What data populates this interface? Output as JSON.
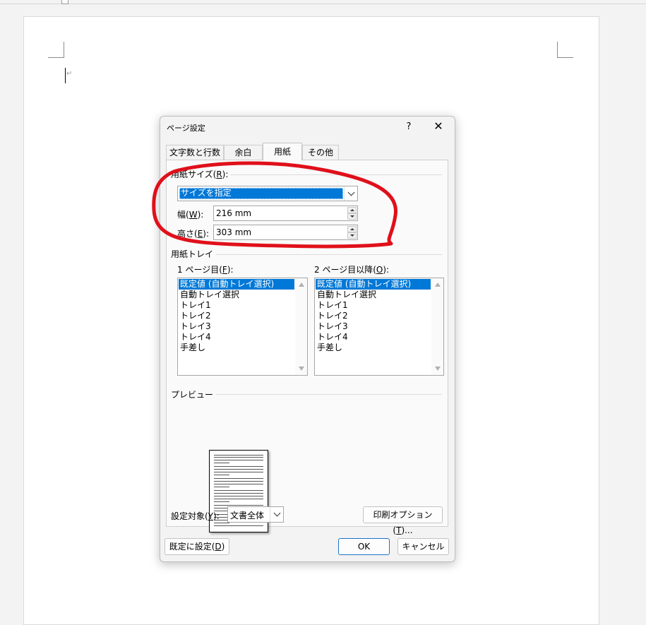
{
  "document": {
    "paragraph_mark": "↵"
  },
  "dialog": {
    "title": "ページ設定",
    "help_label": "?",
    "close_label": "✕",
    "tabs": [
      {
        "label": "文字数と行数",
        "active": false
      },
      {
        "label": "余白",
        "active": false
      },
      {
        "label": "用紙",
        "active": true
      },
      {
        "label": "その他",
        "active": false
      }
    ],
    "paper_size": {
      "group_label": "用紙サイズ(",
      "group_key": "R",
      "group_label_end": "):",
      "selected": "サイズを指定",
      "width_label": "幅(",
      "width_key": "W",
      "width_label_end": "):",
      "width_value": "216 mm",
      "height_label": "高さ(",
      "height_key": "E",
      "height_label_end": "):",
      "height_value": "303 mm"
    },
    "paper_tray": {
      "group_label": "用紙トレイ",
      "first_page_label": "1 ページ目(",
      "first_page_key": "F",
      "first_page_label_end": "):",
      "other_pages_label": "2 ページ目以降(",
      "other_pages_key": "O",
      "other_pages_label_end": "):",
      "items": [
        "既定値 (自動トレイ選択)",
        "自動トレイ選択",
        "トレイ1",
        "トレイ2",
        "トレイ3",
        "トレイ4",
        "手差し"
      ],
      "first_selected_index": 0,
      "other_selected_index": 0
    },
    "preview": {
      "group_label": "プレビュー"
    },
    "apply_to": {
      "label": "設定対象(",
      "key": "Y",
      "label_end": "):",
      "value": "文書全体"
    },
    "print_options_label": "印刷オプション(",
    "print_options_key": "T",
    "print_options_end": ")...",
    "set_default_label": "既定に設定(",
    "set_default_key": "D",
    "set_default_end": ")",
    "ok_label": "OK",
    "cancel_label": "キャンセル"
  },
  "colors": {
    "selection": "#0078d7",
    "annotation": "#e0101a",
    "ok_border": "#1a73c9"
  },
  "icons": [
    "help-icon",
    "close-icon",
    "chevron-down-icon",
    "spin-up-icon",
    "spin-down-icon",
    "scroll-up-icon",
    "scroll-down-icon",
    "paragraph-mark-icon"
  ]
}
